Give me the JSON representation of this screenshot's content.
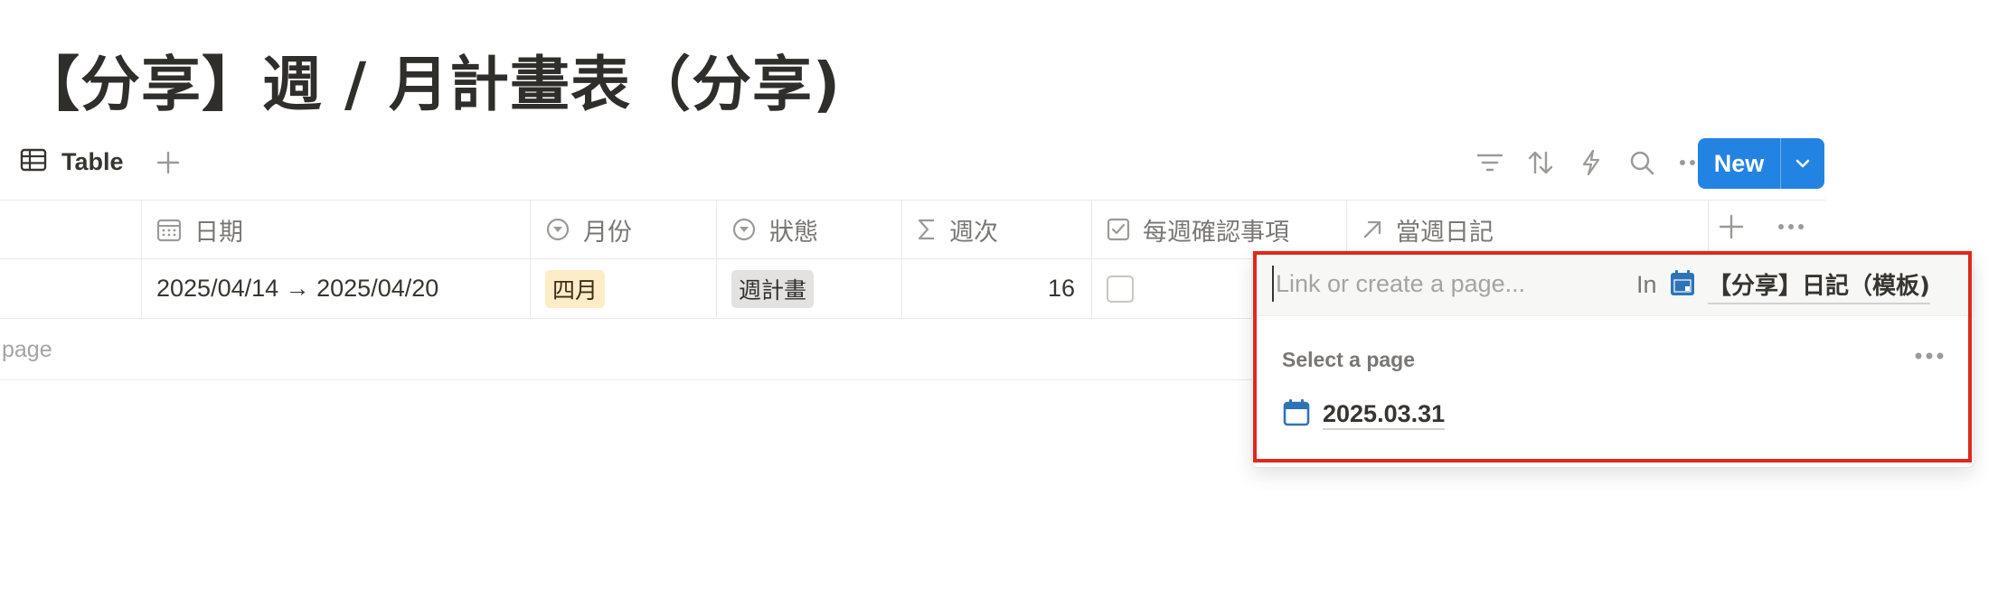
{
  "page": {
    "title": "【分享】週 / 月計畫表（分享)"
  },
  "toolbar": {
    "view_tab_label": "Table",
    "new_button_label": "New",
    "icons": [
      "filter-icon",
      "sort-icon",
      "automation-icon",
      "search-icon",
      "more-icon"
    ]
  },
  "table": {
    "headers": {
      "date": "日期",
      "month": "月份",
      "status": "狀態",
      "week": "週次",
      "weekly_check": "每週確認事項",
      "diary": "當週日記"
    },
    "row": {
      "date": "2025/04/14 → 2025/04/20",
      "month": "四月",
      "status": "週計畫",
      "week": "16",
      "weekly_check_checked": false
    },
    "new_page_text": "page"
  },
  "colors": {
    "accent": "#2383e2",
    "month_tag": "#fdecc8",
    "status_tag": "#e3e2e0",
    "highlight_outline": "#e0281c",
    "calendar_icon": "#2e73b8"
  },
  "popup": {
    "search_placeholder": "Link or create a page...",
    "in_label": "In",
    "database_name": "【分享】日記（模板)",
    "section_label": "Select a page",
    "items": [
      {
        "label": "2025.03.31",
        "icon": "calendar-icon"
      }
    ]
  }
}
